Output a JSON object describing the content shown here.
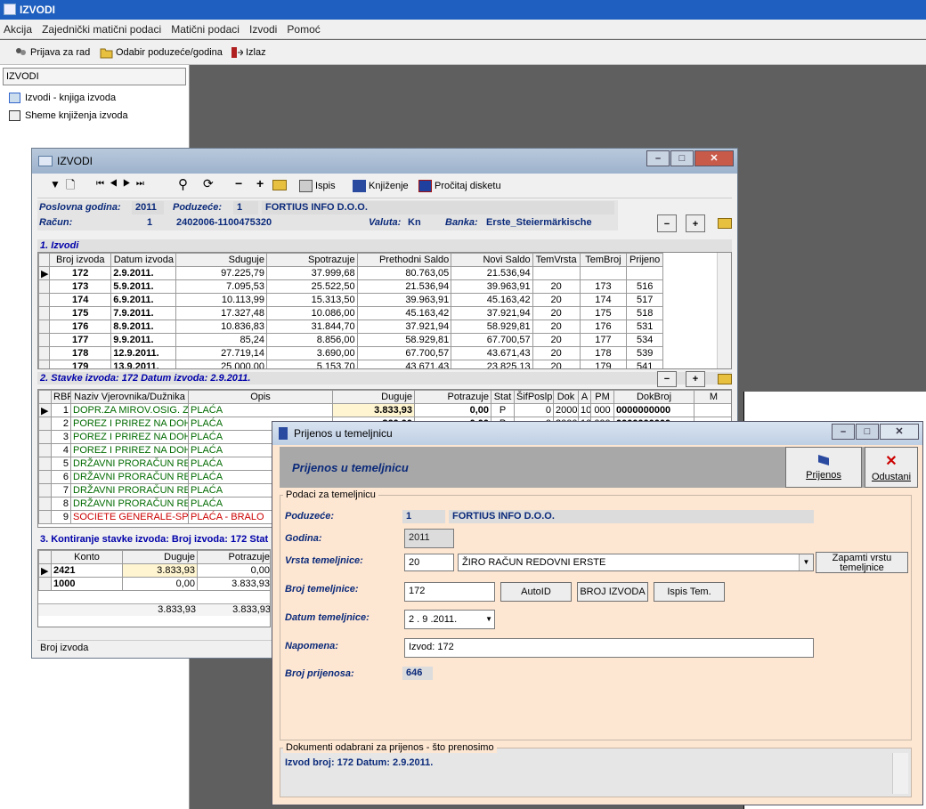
{
  "app": {
    "title": "IZVODI"
  },
  "menu": [
    "Akcija",
    "Zajednički matični podaci",
    "Matični podaci",
    "Izvodi",
    "Pomoć"
  ],
  "toolbar": {
    "login": "Prijava za rad",
    "select_company": "Odabir poduzeće/godina",
    "exit": "Izlaz"
  },
  "left_panel": {
    "header": "IZVODI",
    "items": [
      "Izvodi - knjiga izvoda",
      "Sheme knjiženja izvoda"
    ]
  },
  "izvodi_window": {
    "title": "IZVODI",
    "toolbar": {
      "print": "Ispis",
      "post": "Knjiženje",
      "read_disk": "Pročitaj disketu"
    },
    "header": {
      "year_label": "Poslovna godina:",
      "year": "2011",
      "company_label": "Poduzeće:",
      "company_id": "1",
      "company_name": "FORTIUS INFO D.O.O.",
      "account_label": "Račun:",
      "account_id": "1",
      "account_no": "2402006-1100475320",
      "currency_label": "Valuta:",
      "currency": "Kn",
      "bank_label": "Banka:",
      "bank": "Erste_Steiermärkische"
    },
    "sec1": {
      "title": "1. Izvodi",
      "columns": [
        "Broj izvoda",
        "Datum izvoda",
        "Sduguje",
        "Spotrazuje",
        "Prethodni Saldo",
        "Novi Saldo",
        "TemVrsta",
        "TemBroj",
        "Prijeno"
      ],
      "rows": [
        [
          "172",
          "2.9.2011.",
          "97.225,79",
          "37.999,68",
          "80.763,05",
          "21.536,94",
          "",
          "",
          ""
        ],
        [
          "173",
          "5.9.2011.",
          "7.095,53",
          "25.522,50",
          "21.536,94",
          "39.963,91",
          "20",
          "173",
          "516"
        ],
        [
          "174",
          "6.9.2011.",
          "10.113,99",
          "15.313,50",
          "39.963,91",
          "45.163,42",
          "20",
          "174",
          "517"
        ],
        [
          "175",
          "7.9.2011.",
          "17.327,48",
          "10.086,00",
          "45.163,42",
          "37.921,94",
          "20",
          "175",
          "518"
        ],
        [
          "176",
          "8.9.2011.",
          "10.836,83",
          "31.844,70",
          "37.921,94",
          "58.929,81",
          "20",
          "176",
          "531"
        ],
        [
          "177",
          "9.9.2011.",
          "85,24",
          "8.856,00",
          "58.929,81",
          "67.700,57",
          "20",
          "177",
          "534"
        ],
        [
          "178",
          "12.9.2011.",
          "27.719,14",
          "3.690,00",
          "67.700,57",
          "43.671,43",
          "20",
          "178",
          "539"
        ],
        [
          "179",
          "13.9.2011.",
          "25.000,00",
          "5.153,70",
          "43.671,43",
          "23.825,13",
          "20",
          "179",
          "541"
        ]
      ]
    },
    "sec2": {
      "title": "2. Stavke izvoda: 172   Datum izvoda: 2.9.2011.",
      "columns": [
        "RBR",
        "Naziv Vjerovnika/Dužnika",
        "Opis",
        "Duguje",
        "Potrazuje",
        "Stat",
        "ŠifPoslp",
        "Dok",
        "A",
        "PM",
        "DokBroj",
        "M"
      ],
      "rows": [
        [
          "1",
          "DOPR.ZA  MIROV.OSIG. Z",
          "PLAĆA",
          "3.833,93",
          "0,00",
          "P",
          "0",
          "2000",
          "10",
          "000",
          "0000000000",
          ""
        ],
        [
          "2",
          "POREZ I PRIREZ NA DOH",
          "PLAĆA",
          "360,00",
          "0,00",
          "P",
          "0",
          "2000",
          "10",
          "000",
          "0000000000",
          ""
        ],
        [
          "3",
          "POREZ I PRIREZ NA DOH",
          "PLAĆA",
          "",
          "",
          "",
          "",
          "",
          "",
          "",
          "",
          ""
        ],
        [
          "4",
          "POREZ I PRIREZ NA DOH",
          "PLAĆA",
          "",
          "",
          "",
          "",
          "",
          "",
          "",
          "",
          ""
        ],
        [
          "5",
          "DRŽAVNI PRORAČUN RE",
          "PLAĆA",
          "",
          "",
          "",
          "",
          "",
          "",
          "",
          "",
          ""
        ],
        [
          "6",
          "DRŽAVNI PRORAČUN RE",
          "PLAĆA",
          "",
          "",
          "",
          "",
          "",
          "",
          "",
          "",
          ""
        ],
        [
          "7",
          "DRŽAVNI PRORAČUN RE",
          "PLAĆA",
          "",
          "",
          "",
          "",
          "",
          "",
          "",
          "",
          ""
        ],
        [
          "8",
          "DRŽAVNI PRORAČUN RE",
          "PLAĆA",
          "",
          "",
          "",
          "",
          "",
          "",
          "",
          "",
          ""
        ],
        [
          "9",
          "SOCIETE GENERALE-SPL",
          "PLAĆA - BRALO",
          "",
          "",
          "",
          "",
          "",
          "",
          "",
          "",
          ""
        ]
      ]
    },
    "sec3": {
      "title": "3. Kontiranje stavke izvoda: Broj izvoda: 172   Stat",
      "columns": [
        "Konto",
        "Duguje",
        "Potrazuje"
      ],
      "rows": [
        [
          "2421",
          "3.833,93",
          "0,00"
        ],
        [
          "1000",
          "0,00",
          "3.833,93"
        ]
      ],
      "totals": [
        "3.833,93",
        "3.833,93"
      ]
    },
    "status": "Broj izvoda"
  },
  "dialog": {
    "title": "Prijenos u temeljnicu",
    "heading": "Prijenos u temeljnicu",
    "btn_transfer": "Prijenos",
    "btn_cancel": "Odustani",
    "group_title": "Podaci za temeljnicu",
    "company_label": "Poduzeće:",
    "company_id": "1",
    "company_name": "FORTIUS INFO D.O.O.",
    "year_label": "Godina:",
    "year": "2011",
    "type_label": "Vrsta temeljnice:",
    "type_code": "20",
    "type_name": "ŽIRO RAČUN REDOVNI ERSTE",
    "save_type_btn": "Zapamti vrstu temeljnice",
    "number_label": "Broj temeljnice:",
    "number": "172",
    "autoid_btn": "AutoID",
    "broj_izvoda_btn": "BROJ IZVODA",
    "ispis_btn": "Ispis Tem.",
    "date_label": "Datum temeljnice:",
    "date": "2 . 9 .2011.",
    "note_label": "Napomena:",
    "note": "Izvod: 172",
    "count_label": "Broj prijenosa:",
    "count": "646",
    "docs_title": "Dokumenti odabrani za prijenos - što prenosimo",
    "docs_text": "Izvod broj: 172   Datum: 2.9.2011."
  },
  "colors": {
    "title_blue": "#1f5fbf",
    "label_blue": "#0b2a7a",
    "dialog_bg": "#fde6d2",
    "green_text": "#006a00",
    "red_text": "#cc0000"
  }
}
